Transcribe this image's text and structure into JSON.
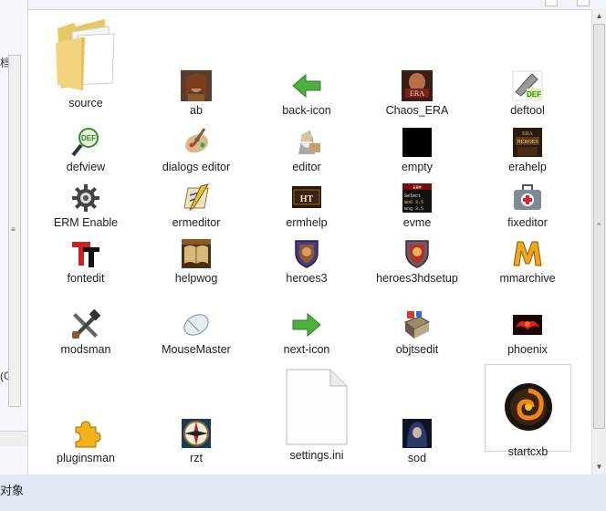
{
  "status": {
    "text": "对象"
  },
  "left_pane": {
    "frag1": "档",
    "frag2": "(G"
  },
  "items": [
    {
      "label": "source",
      "icon": "folder-icon"
    },
    {
      "label": "ab",
      "icon": "character-portrait-icon"
    },
    {
      "label": "back-icon",
      "icon": "green-left-arrow-icon"
    },
    {
      "label": "Chaos_ERA",
      "icon": "era-portrait-icon"
    },
    {
      "label": "deftool",
      "icon": "def-hammer-icon"
    },
    {
      "label": "defview",
      "icon": "def-magnifier-icon"
    },
    {
      "label": "dialogs editor",
      "icon": "paint-brush-icon"
    },
    {
      "label": "editor",
      "icon": "wizard-editor-icon"
    },
    {
      "label": "empty",
      "icon": "black-square-icon"
    },
    {
      "label": "erahelp",
      "icon": "era-book-icon"
    },
    {
      "label": "ERM Enable",
      "icon": "gear-icon"
    },
    {
      "label": "ermeditor",
      "icon": "pencil-scroll-icon"
    },
    {
      "label": "ermhelp",
      "icon": "ht-help-icon"
    },
    {
      "label": "evme",
      "icon": "erm-terminal-icon"
    },
    {
      "label": "fixeditor",
      "icon": "first-aid-kit-icon"
    },
    {
      "label": "fontedit",
      "icon": "font-t-icon"
    },
    {
      "label": "helpwog",
      "icon": "open-book-icon"
    },
    {
      "label": "heroes3",
      "icon": "shield-crest-icon"
    },
    {
      "label": "heroes3hdsetup",
      "icon": "shield-crest-red-icon"
    },
    {
      "label": "mmarchive",
      "icon": "m-letter-icon"
    },
    {
      "label": "modsman",
      "icon": "wrench-hammer-icon"
    },
    {
      "label": "MouseMaster",
      "icon": "mouse-icon"
    },
    {
      "label": "next-icon",
      "icon": "green-right-arrow-icon"
    },
    {
      "label": "objtsedit",
      "icon": "objects-book-icon"
    },
    {
      "label": "phoenix",
      "icon": "phoenix-icon"
    },
    {
      "label": "pluginsman",
      "icon": "puzzle-piece-icon"
    },
    {
      "label": "rzt",
      "icon": "compass-icon"
    },
    {
      "label": "settings.ini",
      "icon": "blank-document-icon"
    },
    {
      "label": "sod",
      "icon": "hooded-figure-icon"
    },
    {
      "label": "startcxb",
      "icon": "swirl-disc-icon"
    }
  ]
}
